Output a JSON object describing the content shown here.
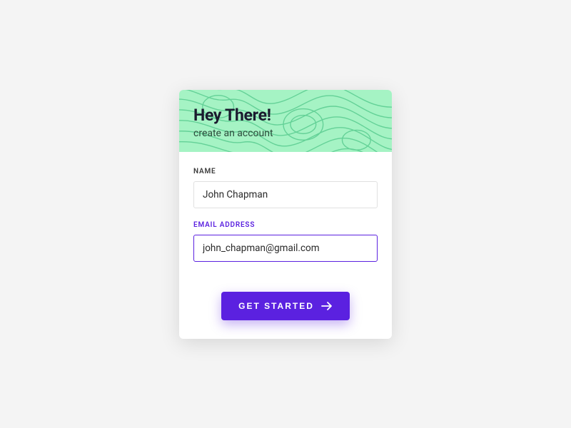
{
  "header": {
    "title": "Hey There!",
    "subtitle": "create an account"
  },
  "form": {
    "name": {
      "label": "NAME",
      "value": "John Chapman"
    },
    "email": {
      "label": "EMAIL ADDRESS",
      "value": "john_chapman@gmail.com"
    }
  },
  "cta": {
    "label": "GET STARTED"
  },
  "colors": {
    "accent": "#5b21e0",
    "headerBg": "#a5f3c4"
  }
}
